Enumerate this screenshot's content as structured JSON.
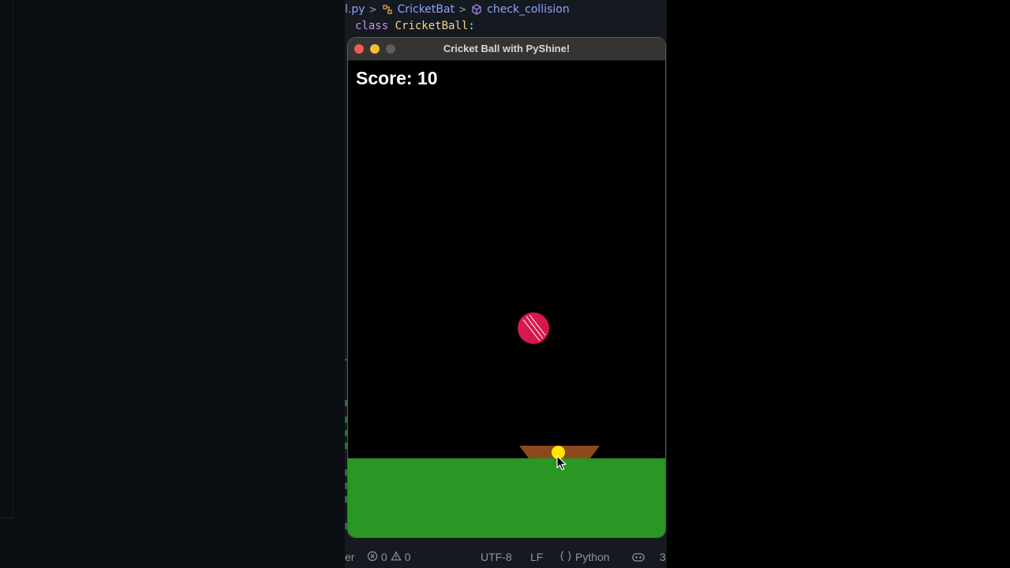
{
  "editor": {
    "breadcrumb": {
      "file": "l.py",
      "class": "CricketBat",
      "method": "check_collision"
    },
    "code": {
      "keyword": "class",
      "class_name": "CricketBall",
      "colon": ":"
    },
    "statusbar": {
      "left_fragment": "er",
      "errors": "0",
      "warnings": "0",
      "encoding": "UTF-8",
      "eol": "LF",
      "language": "Python",
      "right_fragment": "3"
    }
  },
  "game_window": {
    "title": "Cricket Ball with PyShine!",
    "score_label": "Score: 10",
    "colors": {
      "ball": "#d7184c",
      "bat": "#8b4a1e",
      "ground": "#2a9623",
      "hit_dot": "#ffe600",
      "background": "#000000"
    }
  },
  "icons": {
    "breadcrumb_class": "class-icon",
    "breadcrumb_method": "cube-method-icon",
    "status_errors": "error-circle-icon",
    "status_warnings": "warning-triangle-icon",
    "status_language": "braces-icon",
    "status_copilot": "copilot-icon"
  }
}
